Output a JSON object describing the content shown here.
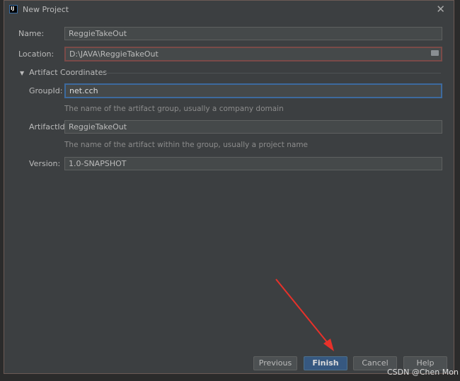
{
  "window": {
    "title": "New Project",
    "close_icon": "close-icon"
  },
  "form": {
    "name": {
      "label": "Name:",
      "value": "ReggieTakeOut"
    },
    "location": {
      "label": "Location:",
      "value": "D:\\JAVA\\ReggieTakeOut"
    },
    "section": "Artifact Coordinates",
    "group_id": {
      "label": "GroupId:",
      "value": "net.cch",
      "hint": "The name of the artifact group, usually a company domain"
    },
    "artifact_id": {
      "label": "ArtifactId:",
      "value": "ReggieTakeOut",
      "hint": "The name of the artifact within the group, usually a project name"
    },
    "version": {
      "label": "Version:",
      "value": "1.0-SNAPSHOT"
    }
  },
  "buttons": {
    "previous": "Previous",
    "finish": "Finish",
    "cancel": "Cancel",
    "help": "Help"
  },
  "watermark": "CSDN @Chen Mon",
  "colors": {
    "accent": "#365880",
    "error_border": "#7a4a48",
    "focus_border": "#3d6a9e",
    "arrow": "#e8312a"
  }
}
